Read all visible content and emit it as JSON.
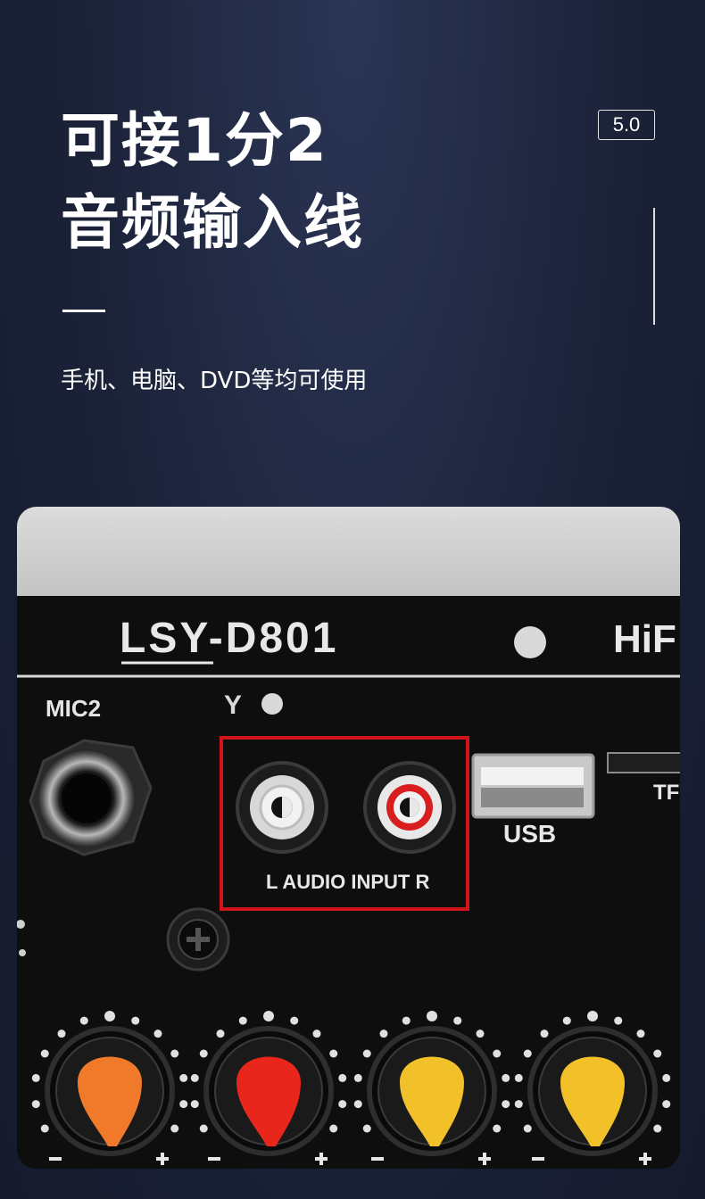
{
  "header": {
    "title_line1": "可接1分2",
    "title_line2": "音频输入线",
    "subtitle": "手机、电脑、DVD等均可使用",
    "version_badge": "5.0"
  },
  "photo": {
    "model_label": "LSY-D801",
    "brand_partial": "HiF",
    "mic_label": "MIC2",
    "usb_label": "USB",
    "tf_label": "TF",
    "audio_input_label": "L  AUDIO INPUT  R",
    "antenna_glyph": "Y",
    "highlight_color": "#d0161b",
    "knob_colors": [
      "#f07a2a",
      "#e8261c",
      "#f2c12a",
      "#f2c12a"
    ]
  }
}
